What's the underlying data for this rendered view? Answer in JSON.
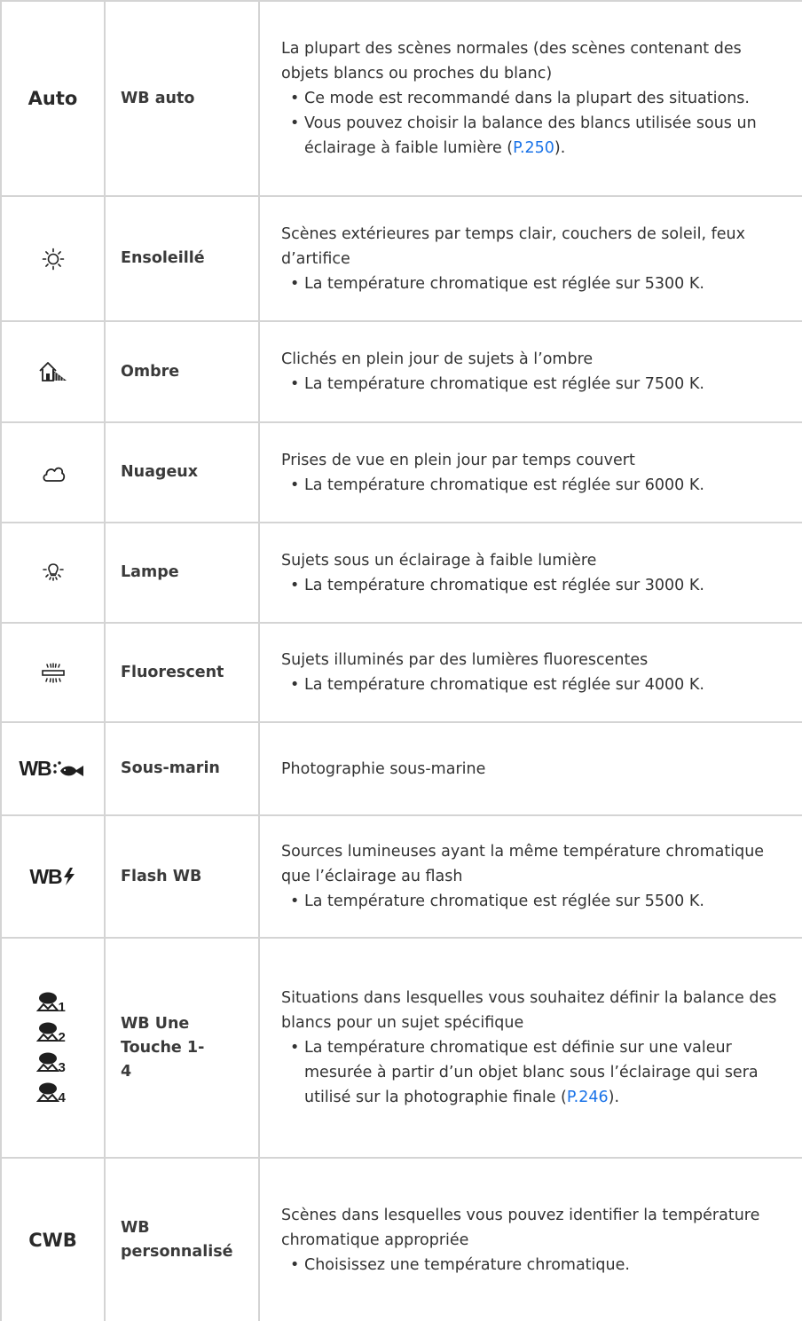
{
  "rows": [
    {
      "mode": "Auto",
      "name": "WB auto",
      "desc": "La plupart des scènes normales (des scènes contenant des objets blancs ou proches du blanc)",
      "bullets": [
        "Ce mode est recommandé dans la plupart des situations.",
        "Vous pouvez choisir la balance des blancs utilisée sous un éclairage à faible lumière ("
      ],
      "link": "P.250",
      "link_after": ")."
    },
    {
      "icon": "sun-icon",
      "name": "Ensoleillé",
      "desc": "Scènes extérieures par temps clair, couchers de soleil, feux d’artifice",
      "bullets": [
        "La température chromatique est réglée sur 5300 K."
      ]
    },
    {
      "icon": "shade-icon",
      "name": "Ombre",
      "desc": "Clichés en plein jour de sujets à l’ombre",
      "bullets": [
        "La température chromatique est réglée sur 7500 K."
      ]
    },
    {
      "icon": "cloud-icon",
      "name": "Nuageux",
      "desc": "Prises de vue en plein jour par temps couvert",
      "bullets": [
        "La température chromatique est réglée sur 6000 K."
      ]
    },
    {
      "icon": "lamp-icon",
      "name": "Lampe",
      "desc": "Sujets sous un éclairage à faible lumière",
      "bullets": [
        "La température chromatique est réglée sur 3000 K."
      ]
    },
    {
      "icon": "fluorescent-icon",
      "name": "Fluorescent",
      "desc": "Sujets illuminés par des lumières fluorescentes",
      "bullets": [
        "La température chromatique est réglée sur 4000 K."
      ]
    },
    {
      "icon": "underwater-wb-icon",
      "icon_text": "WB",
      "name": "Sous-marin",
      "desc": "Photographie sous-marine"
    },
    {
      "icon": "flash-wb-icon",
      "icon_text": "WB",
      "name": "Flash WB",
      "desc": "Sources lumineuses ayant la même température chromatique que l’éclairage au flash",
      "bullets": [
        "La température chromatique est réglée sur 5500 K."
      ]
    },
    {
      "icon": "one-touch-wb-icon",
      "icon_numbers": [
        "1",
        "2",
        "3",
        "4"
      ],
      "name": "WB Une Touche 1-4",
      "desc": "Situations dans lesquelles vous souhaitez définir la balance des blancs pour un sujet spécifique",
      "bullets": [
        "La température chromatique est définie sur une valeur mesurée à partir d’un objet blanc sous l’éclairage qui sera utilisé sur la photographie finale ("
      ],
      "link": "P.246",
      "link_after": ")."
    },
    {
      "mode": "CWB",
      "name": "WB personnalisé",
      "desc": "Scènes dans lesquelles vous pouvez identifier la température chromatique appropriée",
      "bullets": [
        "Choisissez une température chromatique."
      ]
    }
  ],
  "colors": {
    "link": "#1a73e8",
    "border": "#d4d4d4",
    "text": "#333333"
  }
}
